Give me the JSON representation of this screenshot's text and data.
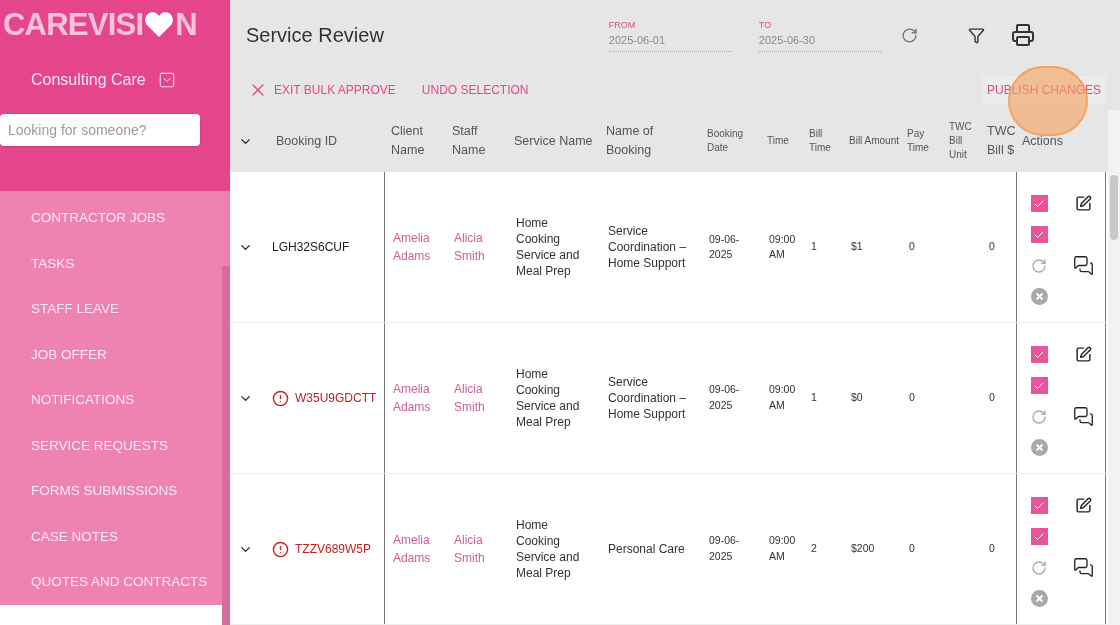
{
  "sidebar": {
    "logo": [
      "CAREVISI",
      "N"
    ],
    "organization": "Consulting Care",
    "search": {
      "placeholder": "Looking for someone?"
    },
    "items": [
      {
        "label": "CONTRACTOR JOBS",
        "selected": false
      },
      {
        "label": "TASKS",
        "selected": false
      },
      {
        "label": "STAFF LEAVE",
        "selected": false
      },
      {
        "label": "JOB OFFER",
        "selected": false
      },
      {
        "label": "NOTIFICATIONS",
        "selected": false
      },
      {
        "label": "SERVICE REQUESTS",
        "selected": false
      },
      {
        "label": "FORMS SUBMISSIONS",
        "selected": false
      },
      {
        "label": "CASE NOTES",
        "selected": false
      },
      {
        "label": "QUOTES AND CONTRACTS",
        "selected": false
      }
    ]
  },
  "header": {
    "title": "Service Review",
    "from": {
      "label": "FROM",
      "value": "2025-06-01"
    },
    "to": {
      "label": "TO",
      "value": "2025-06-30"
    },
    "exit_button": "EXIT BULK APPROVE",
    "undo_button": "UNDO SELECTION",
    "publish_button": "PUBLISH CHANGES"
  },
  "table": {
    "columns": [
      "Booking ID",
      "Client Name",
      "Staff Name",
      "Service Name",
      "Name of Booking",
      "Booking Date",
      "Time",
      "Bill Time",
      "Bill Amount",
      "Pay Time",
      "TWC Bill Unit",
      "TWC Bill $",
      "Actions"
    ],
    "rows": [
      {
        "booking_id": "LGH32S6CUF",
        "warning": false,
        "client": "Amelia Adams",
        "staff": "Alicia Smith",
        "service": "Home Cooking Service and Meal Prep",
        "booking_name": "Service Coordination – Home Support",
        "date": "09-06-2025",
        "time": "09:00 AM",
        "bill_time": "1",
        "bill_amount": "$1",
        "pay_time": "0",
        "twc_amount": "0",
        "checks": [
          {
            "checked": true
          },
          {
            "checked": true
          }
        ]
      },
      {
        "booking_id": "W35U9GDCTT",
        "warning": true,
        "client": "Amelia Adams",
        "staff": "Alicia Smith",
        "service": "Home Cooking Service and Meal Prep",
        "booking_name": "Service Coordination – Home Support",
        "date": "09-06-2025",
        "time": "09:00 AM",
        "bill_time": "1",
        "bill_amount": "$0",
        "pay_time": "0",
        "twc_amount": "0",
        "checks": [
          {
            "checked": true
          },
          {
            "checked": true
          }
        ]
      },
      {
        "booking_id": "TZZV689W5P",
        "warning": true,
        "client": "Amelia Adams",
        "staff": "Alicia Smith",
        "service": "Home Cooking Service and Meal Prep",
        "booking_name": "Personal Care",
        "date": "09-06-2025",
        "time": "09:00 AM",
        "bill_time": "2",
        "bill_amount": "$200",
        "pay_time": "0",
        "twc_amount": "0",
        "checks": [
          {
            "checked": true
          },
          {
            "checked": true
          }
        ]
      }
    ]
  }
}
